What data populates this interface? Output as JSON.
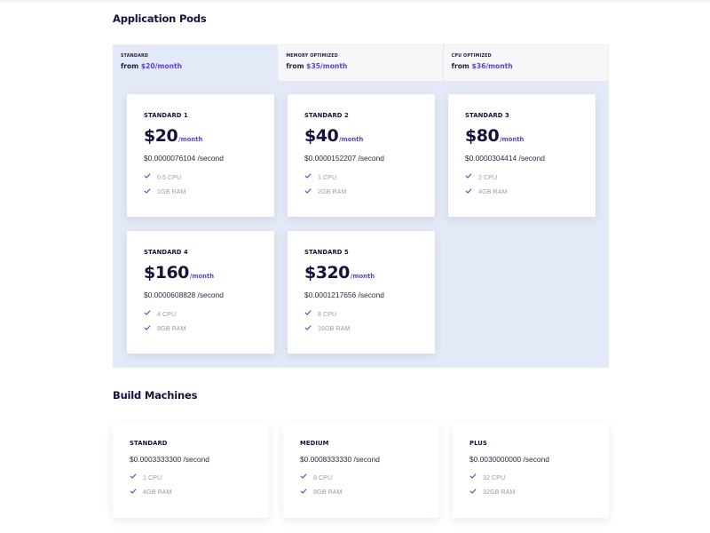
{
  "application_pods": {
    "title": "Application Pods",
    "tabs": [
      {
        "name": "STANDARD",
        "from_label": "from",
        "price": "$20/month",
        "active": true
      },
      {
        "name": "MEMORY OPTIMIZED",
        "from_label": "from",
        "price": "$35/month",
        "active": false
      },
      {
        "name": "CPU OPTIMIZED",
        "from_label": "from",
        "price": "$36/month",
        "active": false
      }
    ],
    "plans": [
      {
        "name": "STANDARD 1",
        "price": "$20",
        "unit": "/month",
        "per_second": "$0.0000076104 /second",
        "features": [
          "0.5 CPU",
          "1GB RAM"
        ]
      },
      {
        "name": "STANDARD 2",
        "price": "$40",
        "unit": "/month",
        "per_second": "$0.0000152207 /second",
        "features": [
          "1 CPU",
          "2GB RAM"
        ]
      },
      {
        "name": "STANDARD 3",
        "price": "$80",
        "unit": "/month",
        "per_second": "$0.0000304414 /second",
        "features": [
          "2 CPU",
          "4GB RAM"
        ]
      },
      {
        "name": "STANDARD 4",
        "price": "$160",
        "unit": "/month",
        "per_second": "$0.0000608828 /second",
        "features": [
          "4 CPU",
          "8GB RAM"
        ]
      },
      {
        "name": "STANDARD 5",
        "price": "$320",
        "unit": "/month",
        "per_second": "$0.0001217656 /second",
        "features": [
          "8 CPU",
          "16GB RAM"
        ]
      }
    ]
  },
  "build_machines": {
    "title": "Build Machines",
    "plans": [
      {
        "name": "STANDARD",
        "per_second": "$0.0003333300 /second",
        "features": [
          "1 CPU",
          "4GB RAM"
        ]
      },
      {
        "name": "MEDIUM",
        "per_second": "$0.0008333330 /second",
        "features": [
          "8 CPU",
          "8GB RAM"
        ]
      },
      {
        "name": "PLUS",
        "per_second": "$0.0030000000 /second",
        "features": [
          "32 CPU",
          "32GB RAM"
        ]
      }
    ]
  },
  "icons": {
    "feature": "check-icon"
  },
  "colors": {
    "accent": "#5b3fd6",
    "heading": "#14133b",
    "panel": "#e3e9f6",
    "muted": "#9c9cab"
  }
}
